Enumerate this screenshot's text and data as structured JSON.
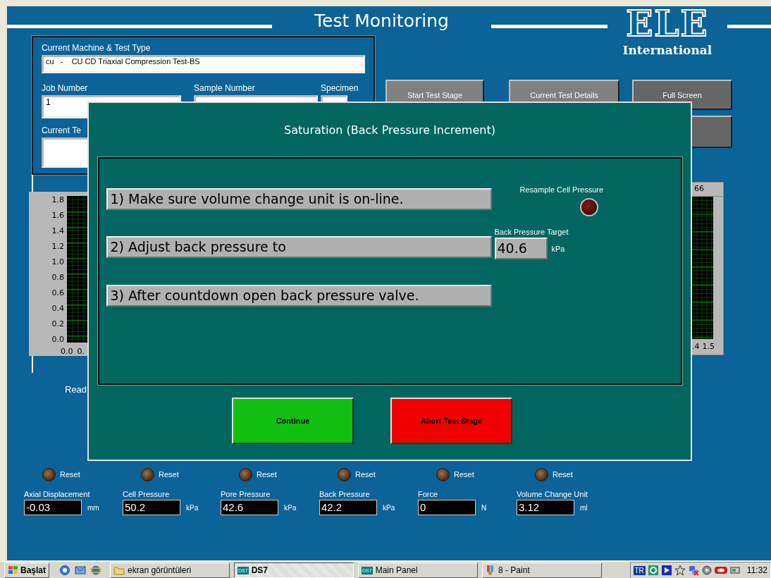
{
  "header": {
    "title": "Test Monitoring",
    "logo": {
      "mark": "ELE",
      "subtitle": "International"
    }
  },
  "info_panel": {
    "machine": {
      "label": "Current Machine & Test Type",
      "value": "cu   -    CU CD Triaxial Compression Test-BS"
    },
    "job": {
      "label": "Job Number",
      "value": "1"
    },
    "sample": {
      "label": "Sample Number"
    },
    "specimen": {
      "label": "Specimen"
    },
    "current": {
      "label": "Current Te"
    }
  },
  "buttons": [
    {
      "label": "Start Test Stage"
    },
    {
      "label": "Current Test Details"
    },
    {
      "label": "Full Screen"
    }
  ],
  "left_chart": {
    "yticks": [
      "1.8",
      "1.6",
      "1.4",
      "1.2",
      "1.0",
      "0.8",
      "0.6",
      "0.4",
      "0.2",
      "0.0"
    ],
    "xticks": [
      "0.0",
      "0."
    ]
  },
  "right_chart": {
    "header": "66",
    "xticks": [
      ".4",
      "1.5"
    ]
  },
  "status_text": "Read",
  "dialog": {
    "title": "Saturation (Back Pressure Increment)",
    "steps": [
      {
        "text": "1) Make sure volume change unit is on-line."
      },
      {
        "text": "2) Adjust back pressure to"
      },
      {
        "text": "3) After countdown open back pressure valve."
      }
    ],
    "resample": {
      "label": "Resample Cell Pressure",
      "on": false
    },
    "target": {
      "label": "Back Pressure Target",
      "value": "40.6",
      "unit": "kPa"
    },
    "continue": "Continue",
    "abort": "Abort Test Stage"
  },
  "readings": [
    {
      "reset": "Reset",
      "label": "Axial Displacement",
      "value": "-0.03",
      "unit": "mm"
    },
    {
      "reset": "Reset",
      "label": "Cell Pressure",
      "value": "50.2",
      "unit": "kPa"
    },
    {
      "reset": "Reset",
      "label": "Pore Pressure",
      "value": "42.6",
      "unit": "kPa"
    },
    {
      "reset": "Reset",
      "label": "Back Pressure",
      "value": "42.2",
      "unit": "kPa"
    },
    {
      "reset": "Reset",
      "label": "Force",
      "value": "0",
      "unit": "N"
    },
    {
      "reset": "Reset",
      "label": "Volume Change Unit",
      "value": "3.12",
      "unit": "ml"
    }
  ],
  "taskbar": {
    "start": "Başlat",
    "tasks": [
      {
        "kind": "folder",
        "label": "ekran görüntüleri",
        "selected": false
      },
      {
        "kind": "app",
        "icon_text": "DS7",
        "label": "DS7",
        "selected": true
      },
      {
        "kind": "app",
        "icon_text": "DS7",
        "label": "Main Panel",
        "selected": false
      },
      {
        "kind": "paint",
        "label": "8 - Paint",
        "selected": false
      }
    ],
    "language": "TR",
    "clock": "11:32"
  }
}
